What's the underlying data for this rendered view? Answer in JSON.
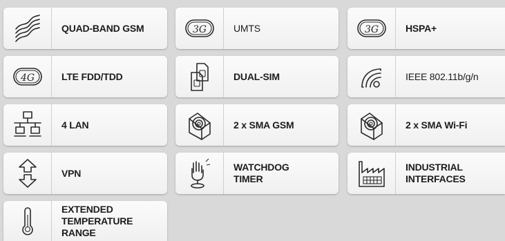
{
  "features": [
    {
      "label": "QUAD-BAND GSM",
      "icon": "waves-icon"
    },
    {
      "label": "UMTS",
      "icon": "3g-icon",
      "icon_text": "3G"
    },
    {
      "label": "HSPA+",
      "icon": "3g-icon",
      "icon_text": "3G"
    },
    {
      "label": "LTE FDD/TDD",
      "icon": "4g-icon",
      "icon_text": "4G"
    },
    {
      "label": "DUAL-SIM",
      "icon": "dual-sim-icon"
    },
    {
      "label": "IEEE 802.11b/g/n",
      "icon": "wifi-icon"
    },
    {
      "label": "4 LAN",
      "icon": "lan-network-icon"
    },
    {
      "label": "2 x SMA GSM",
      "icon": "sma-connector-icon"
    },
    {
      "label": "2 x SMA Wi-Fi",
      "icon": "sma-connector-icon"
    },
    {
      "label": "VPN",
      "icon": "vpn-arrows-icon"
    },
    {
      "label": "WATCHDOG\nTIMER",
      "icon": "watchdog-hand-icon"
    },
    {
      "label": "INDUSTRIAL\nINTERFACES",
      "icon": "factory-icon"
    },
    {
      "label": "EXTENDED\nTEMPERATURE\nRANGE",
      "icon": "thermometer-icon"
    }
  ],
  "colors": {
    "background": "#d9d9d9",
    "tile": "#f5f5f5",
    "text": "#1c1c1c"
  }
}
